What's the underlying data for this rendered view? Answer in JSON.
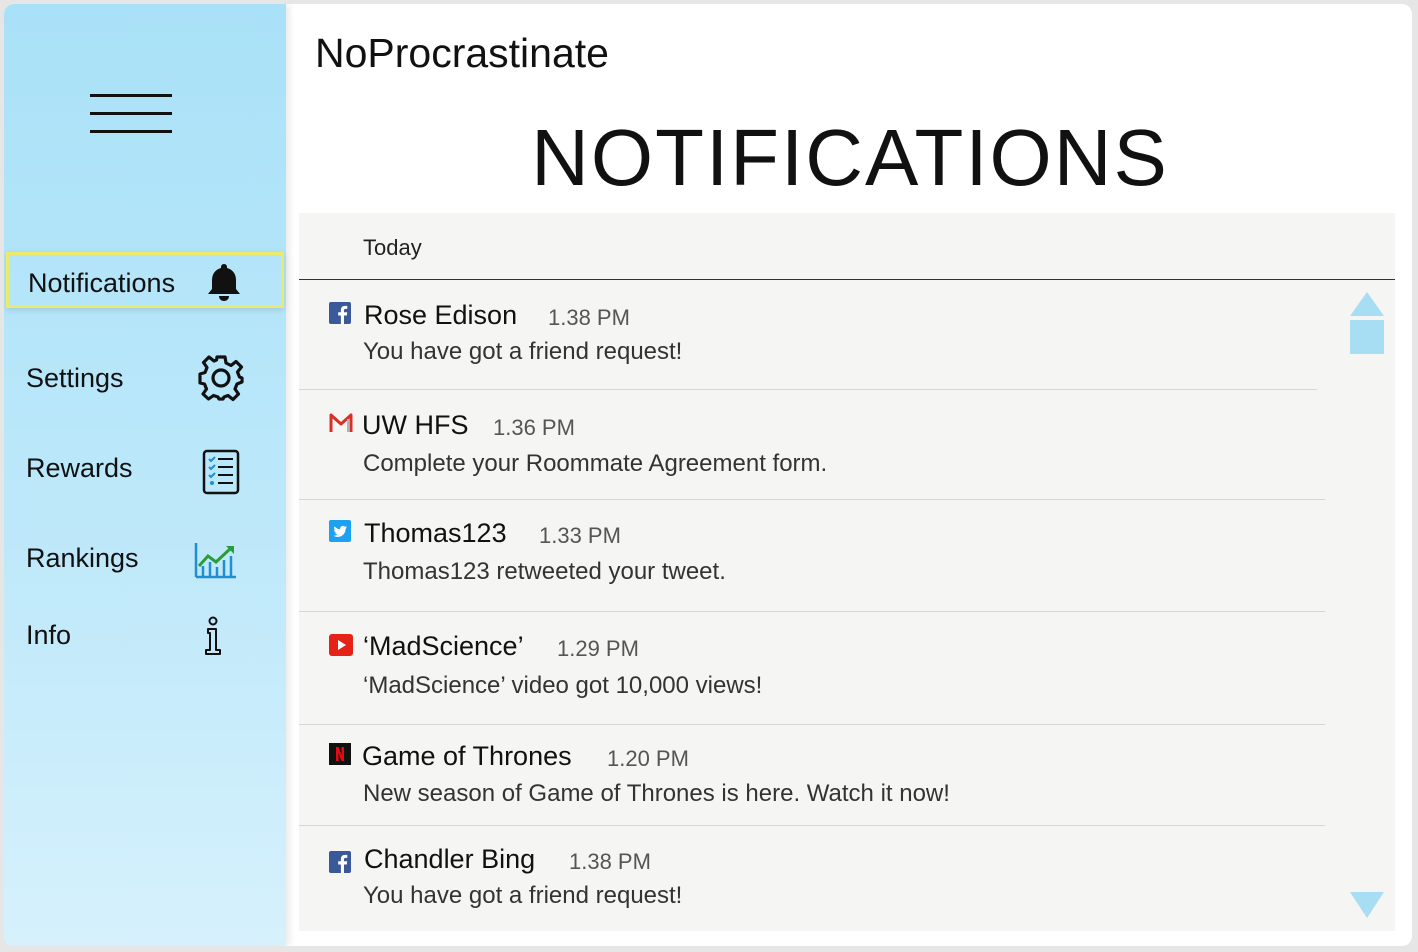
{
  "app": {
    "title": "NoProcrastinate"
  },
  "page": {
    "title": "NOTIFICATIONS"
  },
  "sidebar": {
    "items": [
      {
        "label": "Notifications",
        "icon": "bell-icon",
        "active": true
      },
      {
        "label": "Settings",
        "icon": "gear-icon",
        "active": false
      },
      {
        "label": "Rewards",
        "icon": "checklist-icon",
        "active": false
      },
      {
        "label": "Rankings",
        "icon": "chart-growth-icon",
        "active": false
      },
      {
        "label": "Info",
        "icon": "info-icon",
        "active": false
      }
    ]
  },
  "notifications": {
    "section_label": "Today",
    "items": [
      {
        "app": "facebook",
        "icon": "facebook-icon",
        "sender": "Rose Edison",
        "time": "1.38 PM",
        "message": "You have got a friend request!"
      },
      {
        "app": "gmail",
        "icon": "gmail-icon",
        "sender": "UW HFS",
        "time": "1.36 PM",
        "message": "Complete your Roommate Agreement form."
      },
      {
        "app": "twitter",
        "icon": "twitter-icon",
        "sender": "Thomas123",
        "time": "1.33 PM",
        "message": "Thomas123 retweeted your tweet."
      },
      {
        "app": "youtube",
        "icon": "youtube-icon",
        "sender": "‘MadScience’",
        "time": "1.29 PM",
        "message": "‘MadScience’ video got 10,000 views!"
      },
      {
        "app": "netflix",
        "icon": "netflix-icon",
        "sender": "Game of Thrones",
        "time": "1.20 PM",
        "message": "New season of Game of Thrones is here. Watch it now!"
      },
      {
        "app": "facebook",
        "icon": "facebook-icon",
        "sender": "Chandler Bing",
        "time": "1.38 PM",
        "message": "You have got a friend request!"
      }
    ]
  },
  "colors": {
    "sidebar_top": "#a9e1f8",
    "sidebar_bottom": "#d6f1fc",
    "active_border": "#ecea6a",
    "scroll_arrow": "#a8def4",
    "facebook": "#3b5998",
    "twitter": "#1da1f2",
    "youtube": "#e62117",
    "gmail": "#d93025",
    "netflix": "#e50914"
  }
}
